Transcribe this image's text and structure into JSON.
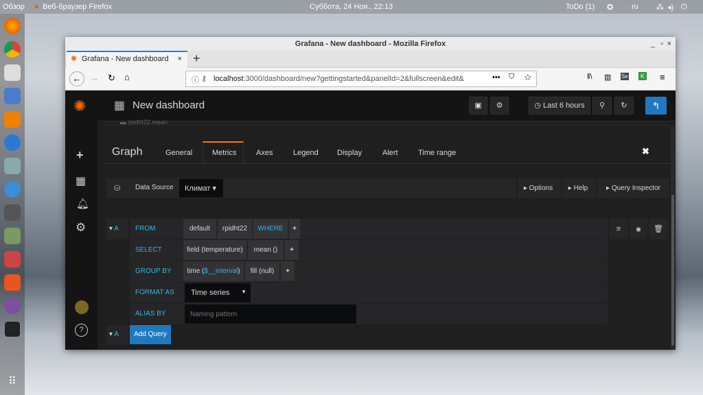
{
  "desktop": {
    "activities": "Обзор",
    "app_menu": "Веб-браузер Firefox",
    "clock": "Суббота, 24 Ноя., 22:13",
    "todo": "ToDo (1)",
    "lang": "ru"
  },
  "browser": {
    "window_title": "Grafana - New dashboard - Mozilla Firefox",
    "tab_title": "Grafana - New dashboard",
    "url_host": "localhost",
    "url_rest": ":3000/dashboard/new?gettingstarted&panelId=2&fullscreen&edit&"
  },
  "grafana": {
    "dashboard_title": "New dashboard",
    "time_range": "Last 6 hours",
    "legend_series": "rpidht22.mean",
    "panel_type": "Graph",
    "tabs": [
      "General",
      "Metrics",
      "Axes",
      "Legend",
      "Display",
      "Alert",
      "Time range"
    ],
    "active_tab": "Metrics",
    "datasource_label": "Data Source",
    "datasource_value": "Климат",
    "options": "Options",
    "help": "Help",
    "query_inspector": "Query Inspector",
    "query": {
      "ref": "A",
      "from_label": "FROM",
      "policy": "default",
      "measurement": "rpidht22",
      "where": "WHERE",
      "select_label": "SELECT",
      "field": "field (temperature)",
      "func": "mean ()",
      "group_label": "GROUP BY",
      "time_prefix": "time (",
      "time_var": "$__interval",
      "time_suffix": ")",
      "fill": "fill (null)",
      "format_label": "FORMAT AS",
      "format_value": "Time series",
      "alias_label": "ALIAS BY",
      "alias_placeholder": "Naming pattern"
    },
    "add_query": "Add Query",
    "add_ref": "A",
    "plus": "+"
  }
}
